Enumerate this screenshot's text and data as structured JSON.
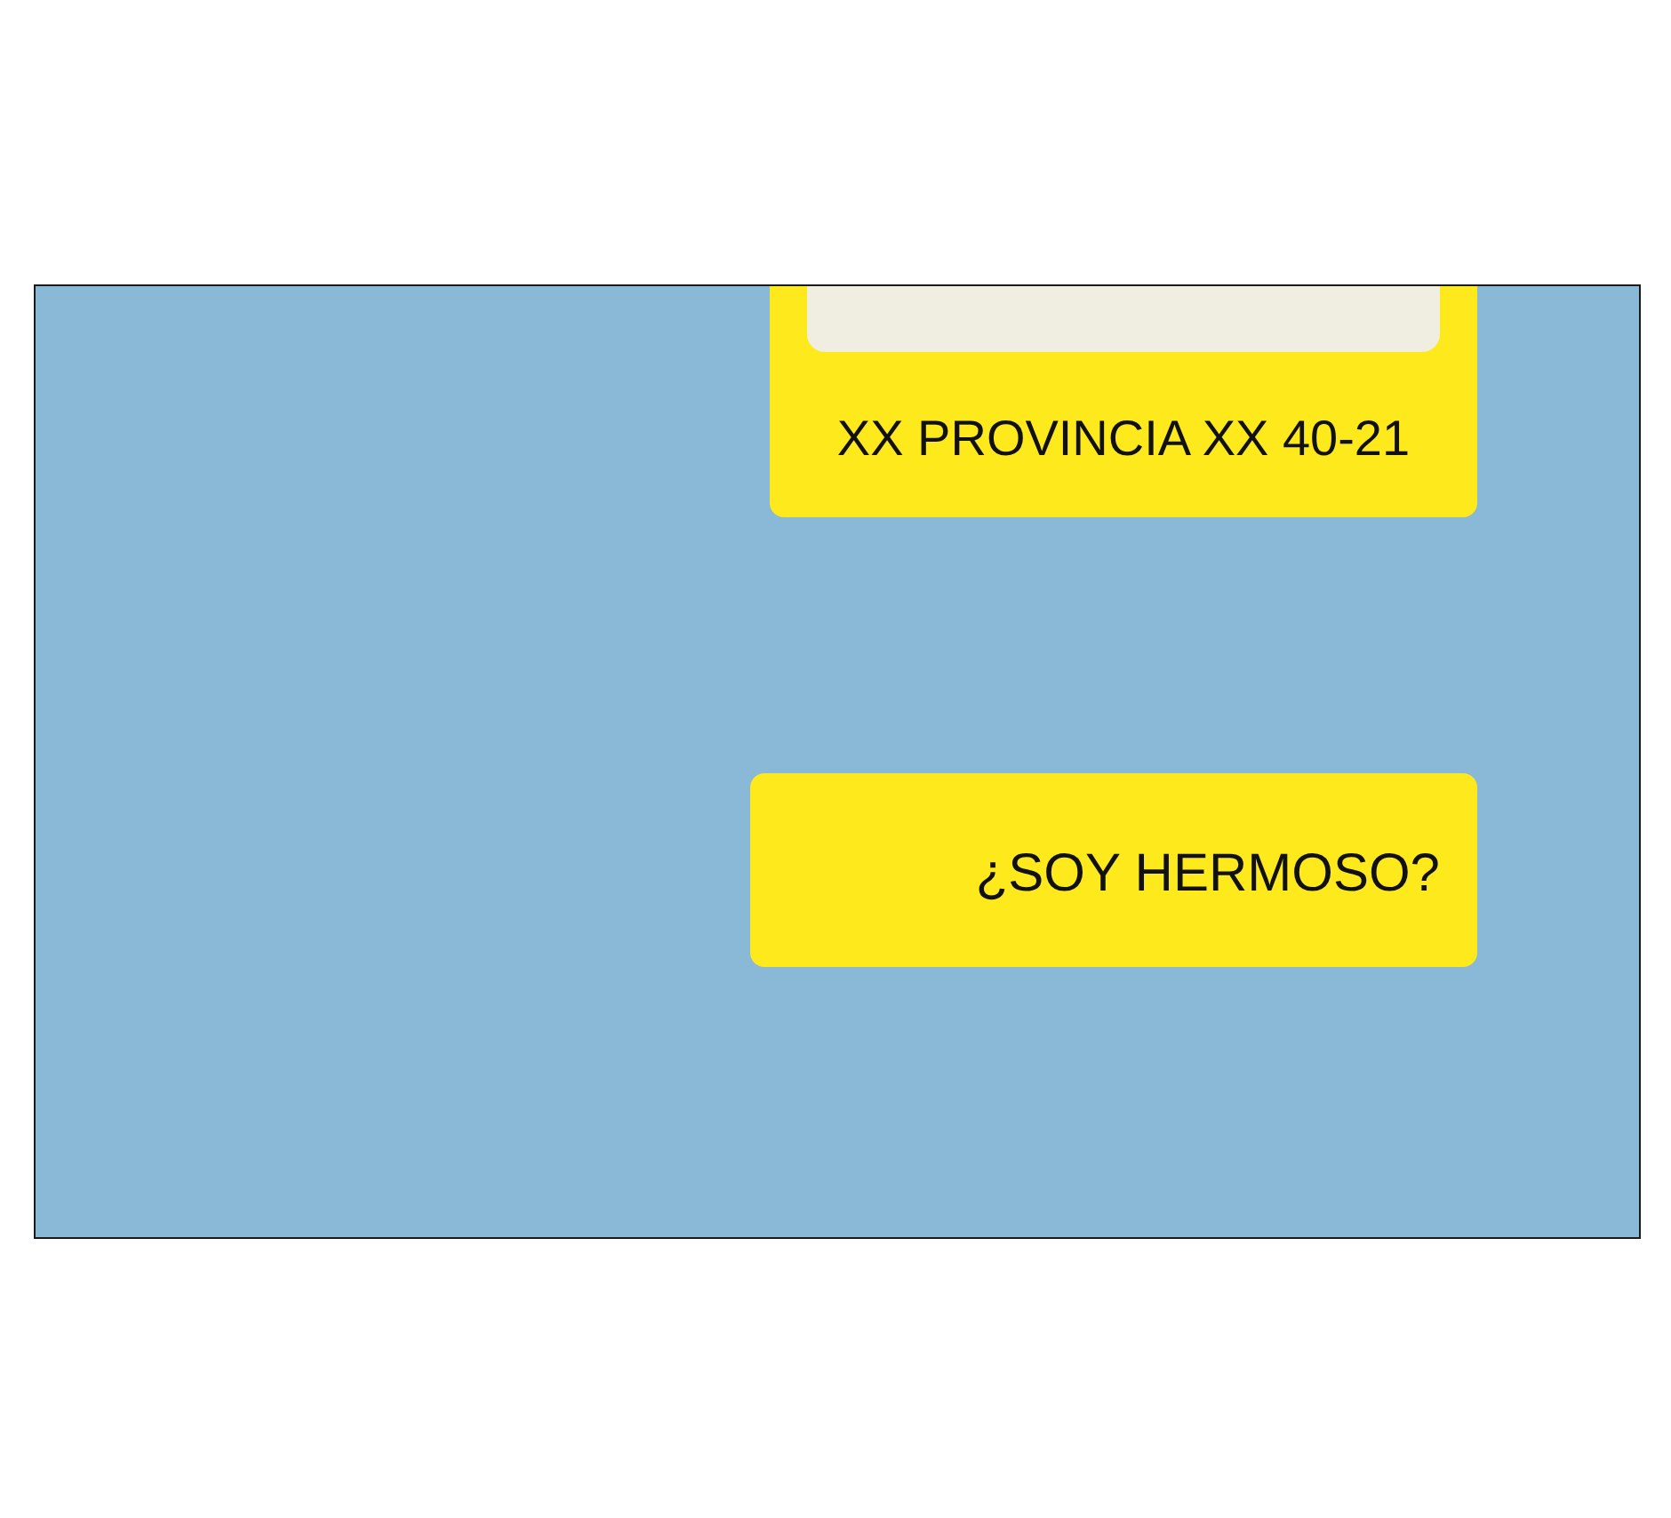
{
  "messages": [
    {
      "kind": "reply",
      "text": "XX PROVINCIA XX 40-21"
    },
    {
      "kind": "plain",
      "text": "¿SOY HERMOSO?"
    }
  ]
}
